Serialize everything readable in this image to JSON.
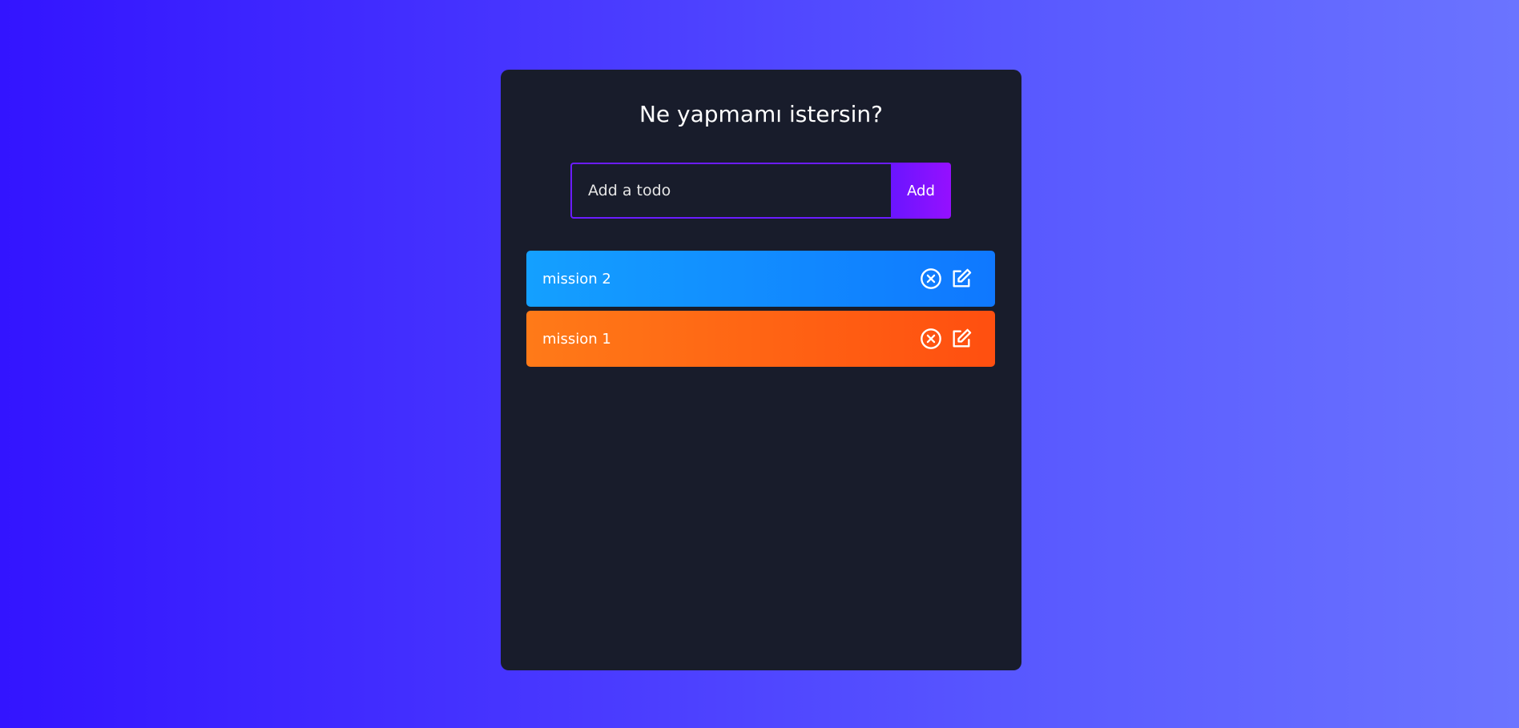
{
  "app": {
    "title": "Ne yapmamı istersin?",
    "input_placeholder": "Add a todo",
    "input_value": "",
    "add_label": "Add"
  },
  "todos": [
    {
      "text": "mission 2",
      "color": "#1296ff"
    },
    {
      "text": "mission 1",
      "color": "#ff6a16"
    }
  ],
  "icons": {
    "delete": "close-circle-icon",
    "edit": "edit-icon"
  },
  "colors": {
    "background_start": "#3314ff",
    "background_end": "#6b74ff",
    "panel": "#181c2b",
    "accent": "#6b1cff"
  }
}
